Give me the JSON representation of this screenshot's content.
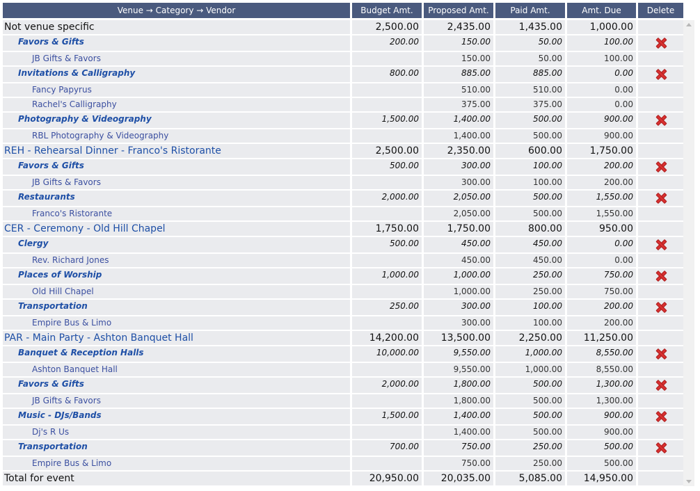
{
  "header": {
    "columns": [
      "Venue → Category → Vendor",
      "Budget Amt.",
      "Proposed Amt.",
      "Paid Amt.",
      "Amt. Due",
      "Delete"
    ]
  },
  "rows": [
    {
      "level": "venue",
      "plain": true,
      "name": "Not venue specific",
      "budget": "2,500.00",
      "proposed": "2,435.00",
      "paid": "1,435.00",
      "due": "1,000.00"
    },
    {
      "level": "category",
      "name": "Favors & Gifts",
      "budget": "200.00",
      "proposed": "150.00",
      "paid": "50.00",
      "due": "100.00",
      "delete": true
    },
    {
      "level": "vendor",
      "name": "JB Gifts & Favors",
      "budget": "",
      "proposed": "150.00",
      "paid": "50.00",
      "due": "100.00"
    },
    {
      "level": "category",
      "name": "Invitations & Calligraphy",
      "budget": "800.00",
      "proposed": "885.00",
      "paid": "885.00",
      "due": "0.00",
      "delete": true
    },
    {
      "level": "vendor",
      "name": "Fancy Papyrus",
      "budget": "",
      "proposed": "510.00",
      "paid": "510.00",
      "due": "0.00"
    },
    {
      "level": "vendor",
      "name": "Rachel's Calligraphy",
      "budget": "",
      "proposed": "375.00",
      "paid": "375.00",
      "due": "0.00"
    },
    {
      "level": "category",
      "name": "Photography & Videography",
      "budget": "1,500.00",
      "proposed": "1,400.00",
      "paid": "500.00",
      "due": "900.00",
      "delete": true
    },
    {
      "level": "vendor",
      "name": "RBL Photography & Videography",
      "budget": "",
      "proposed": "1,400.00",
      "paid": "500.00",
      "due": "900.00"
    },
    {
      "level": "venue",
      "name": "REH - Rehearsal Dinner - Franco's Ristorante",
      "budget": "2,500.00",
      "proposed": "2,350.00",
      "paid": "600.00",
      "due": "1,750.00"
    },
    {
      "level": "category",
      "name": "Favors & Gifts",
      "budget": "500.00",
      "proposed": "300.00",
      "paid": "100.00",
      "due": "200.00",
      "delete": true
    },
    {
      "level": "vendor",
      "name": "JB Gifts & Favors",
      "budget": "",
      "proposed": "300.00",
      "paid": "100.00",
      "due": "200.00"
    },
    {
      "level": "category",
      "name": "Restaurants",
      "budget": "2,000.00",
      "proposed": "2,050.00",
      "paid": "500.00",
      "due": "1,550.00",
      "delete": true
    },
    {
      "level": "vendor",
      "name": "Franco's Ristorante",
      "budget": "",
      "proposed": "2,050.00",
      "paid": "500.00",
      "due": "1,550.00"
    },
    {
      "level": "venue",
      "name": "CER - Ceremony - Old Hill Chapel",
      "budget": "1,750.00",
      "proposed": "1,750.00",
      "paid": "800.00",
      "due": "950.00"
    },
    {
      "level": "category",
      "name": "Clergy",
      "budget": "500.00",
      "proposed": "450.00",
      "paid": "450.00",
      "due": "0.00",
      "delete": true
    },
    {
      "level": "vendor",
      "name": "Rev. Richard Jones",
      "budget": "",
      "proposed": "450.00",
      "paid": "450.00",
      "due": "0.00"
    },
    {
      "level": "category",
      "name": "Places of Worship",
      "budget": "1,000.00",
      "proposed": "1,000.00",
      "paid": "250.00",
      "due": "750.00",
      "delete": true
    },
    {
      "level": "vendor",
      "name": "Old Hill Chapel",
      "budget": "",
      "proposed": "1,000.00",
      "paid": "250.00",
      "due": "750.00"
    },
    {
      "level": "category",
      "name": "Transportation",
      "budget": "250.00",
      "proposed": "300.00",
      "paid": "100.00",
      "due": "200.00",
      "delete": true
    },
    {
      "level": "vendor",
      "name": "Empire Bus & Limo",
      "budget": "",
      "proposed": "300.00",
      "paid": "100.00",
      "due": "200.00"
    },
    {
      "level": "venue",
      "name": "PAR - Main Party - Ashton Banquet Hall",
      "budget": "14,200.00",
      "proposed": "13,500.00",
      "paid": "2,250.00",
      "due": "11,250.00"
    },
    {
      "level": "category",
      "name": "Banquet & Reception Halls",
      "budget": "10,000.00",
      "proposed": "9,550.00",
      "paid": "1,000.00",
      "due": "8,550.00",
      "delete": true
    },
    {
      "level": "vendor",
      "name": "Ashton Banquet Hall",
      "budget": "",
      "proposed": "9,550.00",
      "paid": "1,000.00",
      "due": "8,550.00"
    },
    {
      "level": "category",
      "name": "Favors & Gifts",
      "budget": "2,000.00",
      "proposed": "1,800.00",
      "paid": "500.00",
      "due": "1,300.00",
      "delete": true
    },
    {
      "level": "vendor",
      "name": "JB Gifts & Favors",
      "budget": "",
      "proposed": "1,800.00",
      "paid": "500.00",
      "due": "1,300.00"
    },
    {
      "level": "category",
      "name": "Music - DJs/Bands",
      "budget": "1,500.00",
      "proposed": "1,400.00",
      "paid": "500.00",
      "due": "900.00",
      "delete": true
    },
    {
      "level": "vendor",
      "name": "Dj's R Us",
      "budget": "",
      "proposed": "1,400.00",
      "paid": "500.00",
      "due": "900.00"
    },
    {
      "level": "category",
      "name": "Transportation",
      "budget": "700.00",
      "proposed": "750.00",
      "paid": "250.00",
      "due": "500.00",
      "delete": true
    },
    {
      "level": "vendor",
      "name": "Empire Bus & Limo",
      "budget": "",
      "proposed": "750.00",
      "paid": "250.00",
      "due": "500.00"
    },
    {
      "level": "venue",
      "plain": true,
      "name": "Total for event",
      "budget": "20,950.00",
      "proposed": "20,035.00",
      "paid": "5,085.00",
      "due": "14,950.00"
    }
  ],
  "icons": {
    "delete": "red-x-icon",
    "scroll_up": "scroll-up-arrow",
    "scroll_down": "scroll-down-arrow"
  }
}
